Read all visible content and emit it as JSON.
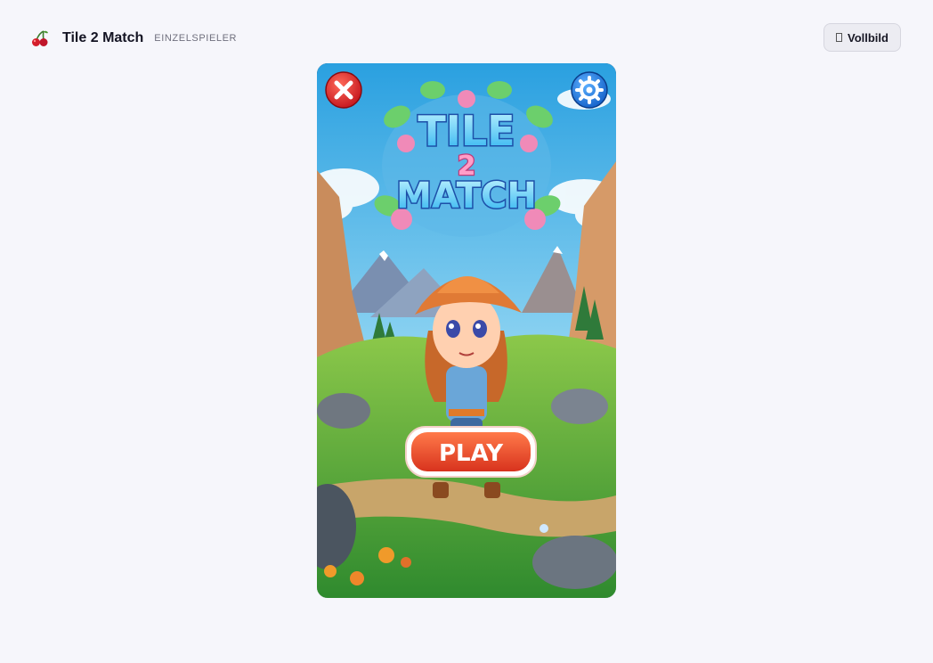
{
  "header": {
    "logo_icon": "cherry-icon",
    "title": "Tile 2 Match",
    "mode": "EINZELSPIELER"
  },
  "fullscreen": {
    "icon": "fullscreen-icon",
    "label": "Vollbild"
  },
  "game": {
    "logo": {
      "line1": "TILE",
      "number": "2",
      "line2": "MATCH"
    },
    "close_icon": "close-icon",
    "settings_icon": "gear-icon",
    "play_label": "PLAY"
  },
  "colors": {
    "page_bg": "#f6f6fb",
    "play_red": "#e8452c",
    "close_red": "#e0262a",
    "settings_blue": "#1f7ae0",
    "logo_cyan": "#5fd7ff"
  }
}
